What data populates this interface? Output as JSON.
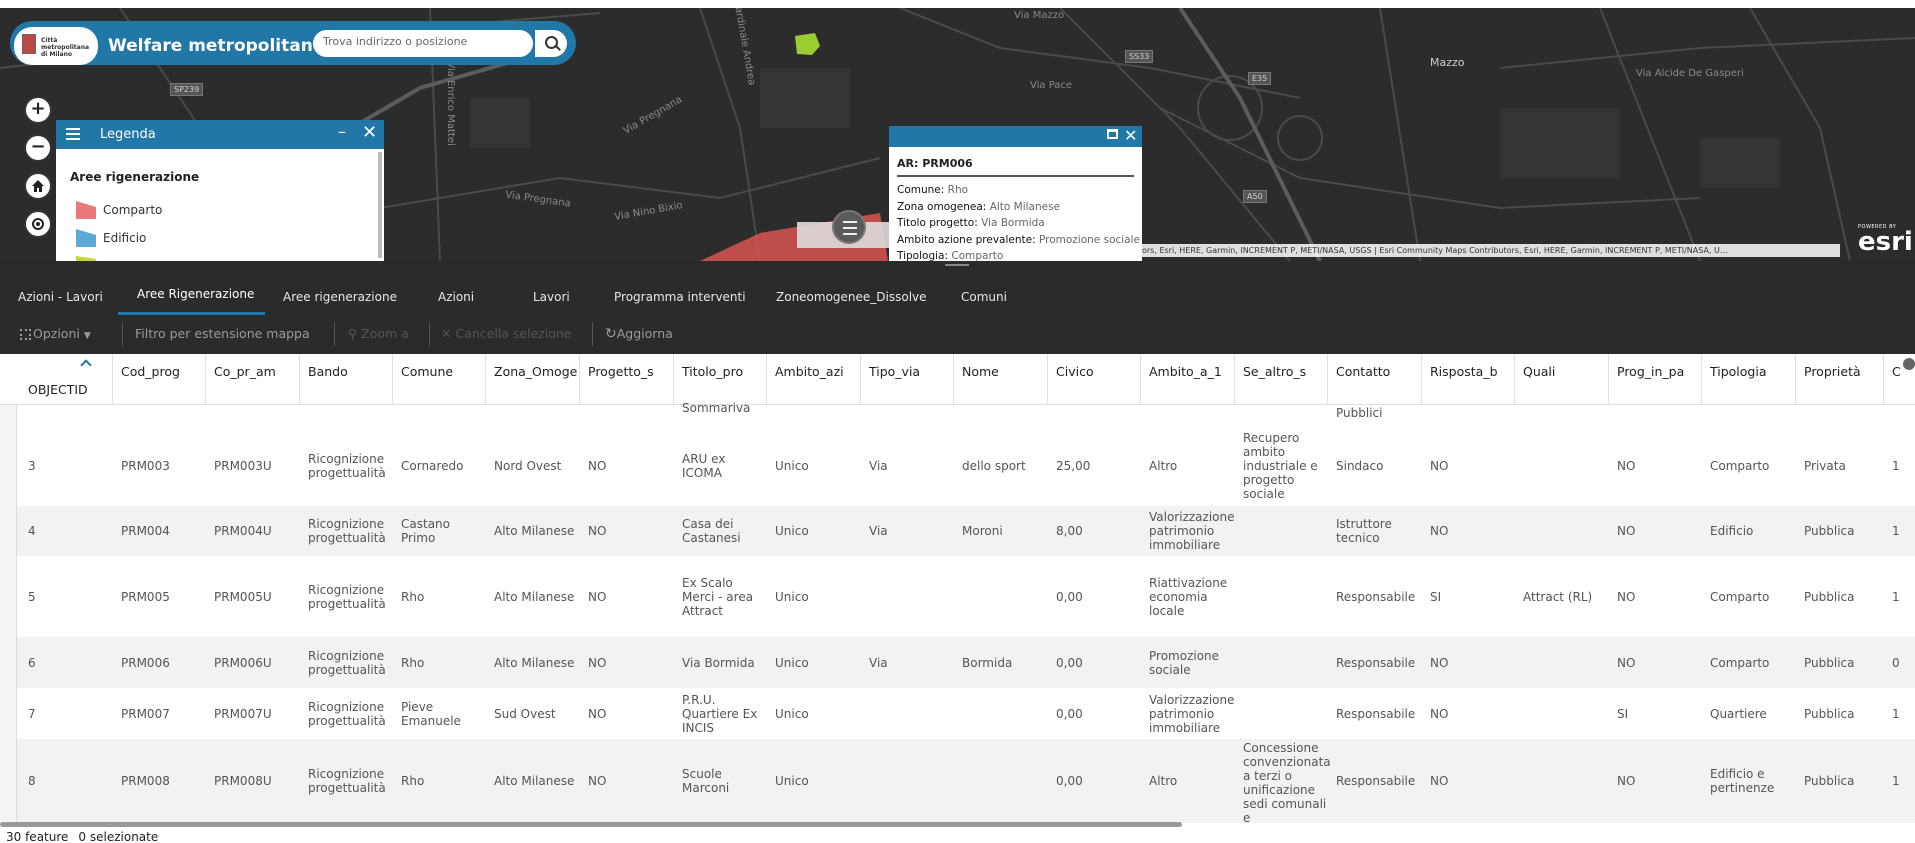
{
  "app": {
    "title": "Welfare metropolitano",
    "logo_text": "Città metropolitana di Milano"
  },
  "search": {
    "placeholder": "Trova indirizzo o posizione"
  },
  "map": {
    "controls": {
      "zoom_in": "+",
      "zoom_out": "−"
    },
    "road_labels": [
      "Via Mazzo",
      "Via Pace",
      "Via Pregnana",
      "Via Nino Bixio",
      "Via Enrico Mattei",
      "Via Cardinale Andrea",
      "Via Alcide De Gasperi",
      "Mazzo",
      "Via Pregnana"
    ],
    "shields": [
      "SP239",
      "SS33",
      "E35",
      "A50"
    ],
    "attribution": "ors, Esri, HERE, Garmin, INCREMENT P, METI/NASA, USGS | Esri Community Maps Contributors, Esri, HERE, Garmin, INCREMENT P, METI/NASA, U...",
    "esri": {
      "powered_by": "POWERED BY",
      "logo": "esri"
    }
  },
  "legend": {
    "title": "Legenda",
    "minimize": "–",
    "close": "✕",
    "section": "Aree rigenerazione",
    "items": [
      {
        "label": "Comparto",
        "color": "#e8787a"
      },
      {
        "label": "Edificio",
        "color": "#5ba9d4"
      }
    ]
  },
  "popup": {
    "title": "AR: PRM006",
    "close": "✕",
    "rows": [
      {
        "label": "Comune",
        "value": "Rho"
      },
      {
        "label": "Zona omogenea",
        "value": "Alto Milanese"
      },
      {
        "label": "Titolo progetto",
        "value": "Via Bormida"
      },
      {
        "label": "Ambito azione prevalente",
        "value": "Promozione sociale"
      },
      {
        "label": "Tipologia",
        "value": "Comparto"
      }
    ]
  },
  "tabs": {
    "items": [
      "Azioni - Lavori",
      "Aree Rigenerazione",
      "Aree rigenerazione",
      "Azioni",
      "Lavori",
      "Programma interventi",
      "Zoneomogenee_Dissolve",
      "Comuni"
    ],
    "active_index": 1
  },
  "toolbar": {
    "options": "Opzioni",
    "filter": "Filtro per estensione mappa",
    "zoom": "Zoom a",
    "clear": "Cancella selezione",
    "refresh": "Aggiorna"
  },
  "table": {
    "columns": [
      "OBJECTID",
      "Cod_prog",
      "Co_pr_am",
      "Bando",
      "Comune",
      "Zona_Omoge",
      "Progetto_s",
      "Titolo_pro",
      "Ambito_azi",
      "Tipo_via",
      "Nome",
      "Civico",
      "Ambito_a_1",
      "Se_altro_s",
      "Contatto",
      "Risposta_b",
      "Quali",
      "Prog_in_pa",
      "Tipologia",
      "Proprietà",
      "C"
    ],
    "partial_top": {
      "titolo": "Sommariva",
      "contatto": "Pubblici"
    },
    "rows": [
      [
        "3",
        "PRM003",
        "PRM003U",
        "Ricognizione progettualità",
        "Cornaredo",
        "Nord Ovest",
        "NO",
        "ARU ex ICOMA",
        "Unico",
        "Via",
        "dello sport",
        "25,00",
        "Altro",
        "Recupero ambito industriale e progetto sociale",
        "Sindaco",
        "NO",
        "",
        "NO",
        "Comparto",
        "Privata",
        "1"
      ],
      [
        "4",
        "PRM004",
        "PRM004U",
        "Ricognizione progettualità",
        "Castano Primo",
        "Alto Milanese",
        "NO",
        "Casa dei Castanesi",
        "Unico",
        "Via",
        "Moroni",
        "8,00",
        "Valorizzazione patrimonio immobiliare",
        "",
        "Istruttore tecnico",
        "NO",
        "",
        "NO",
        "Edificio",
        "Pubblica",
        "1"
      ],
      [
        "5",
        "PRM005",
        "PRM005U",
        "Ricognizione progettualità",
        "Rho",
        "Alto Milanese",
        "NO",
        "Ex Scalo Merci - area Attract",
        "Unico",
        "",
        "",
        "0,00",
        "Riattivazione economia locale",
        "",
        "Responsabile",
        "SI",
        "Attract (RL)",
        "NO",
        "Comparto",
        "Pubblica",
        "1"
      ],
      [
        "6",
        "PRM006",
        "PRM006U",
        "Ricognizione progettualità",
        "Rho",
        "Alto Milanese",
        "NO",
        "Via Bormida",
        "Unico",
        "Via",
        "Bormida",
        "0,00",
        "Promozione sociale",
        "",
        "Responsabile",
        "NO",
        "",
        "NO",
        "Comparto",
        "Pubblica",
        "0"
      ],
      [
        "7",
        "PRM007",
        "PRM007U",
        "Ricognizione progettualità",
        "Pieve Emanuele",
        "Sud Ovest",
        "NO",
        "P.R.U. Quartiere Ex INCIS",
        "Unico",
        "",
        "",
        "0,00",
        "Valorizzazione patrimonio immobiliare",
        "",
        "Responsabile",
        "NO",
        "",
        "SI",
        "Quartiere",
        "Pubblica",
        "1"
      ],
      [
        "8",
        "PRM008",
        "PRM008U",
        "Ricognizione progettualità",
        "Rho",
        "Alto Milanese",
        "NO",
        "Scuole Marconi",
        "Unico",
        "",
        "",
        "0,00",
        "Altro",
        "Concessione convenzionata a terzi o unificazione sedi comunali e",
        "Responsabile",
        "NO",
        "",
        "NO",
        "Edificio e pertinenze",
        "Pubblica",
        "1"
      ]
    ]
  },
  "footer": {
    "feature_count": "30 feature",
    "selected_count": "0 selezionate"
  },
  "colors": {
    "brand_blue": "#2178a7",
    "map_bg": "#2c2c2c",
    "toolbar_bg": "#2b2b2b",
    "highlight_red": "#d9534f"
  }
}
